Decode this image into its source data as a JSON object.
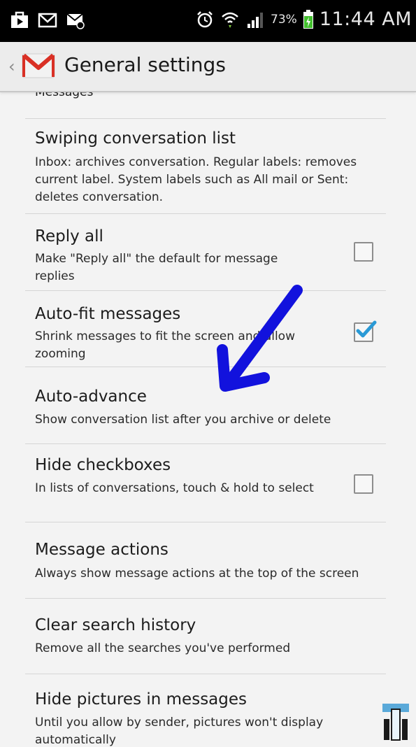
{
  "status_bar": {
    "battery_percent": "73%",
    "time": "11:44 AM"
  },
  "action_bar": {
    "title": "General settings"
  },
  "settings": {
    "partial_top": "Messages",
    "items": [
      {
        "title": "Swiping conversation list",
        "subtitle": "Inbox: archives conversation. Regular labels: removes current label. System labels such as All mail or Sent: deletes conversation.",
        "checkbox": null
      },
      {
        "title": "Reply all",
        "subtitle": "Make \"Reply all\" the default for message replies",
        "checkbox": false
      },
      {
        "title": "Auto-fit messages",
        "subtitle": "Shrink messages to fit the screen and allow zooming",
        "checkbox": true
      },
      {
        "title": "Auto-advance",
        "subtitle": "Show conversation list after you archive or delete",
        "checkbox": null
      },
      {
        "title": "Hide checkboxes",
        "subtitle": "In lists of conversations, touch & hold to select",
        "checkbox": false
      },
      {
        "title": "Message actions",
        "subtitle": "Always show message actions at the top of the screen",
        "checkbox": null
      },
      {
        "title": "Clear search history",
        "subtitle": "Remove all the searches you've performed",
        "checkbox": null
      },
      {
        "title": "Hide pictures in messages",
        "subtitle": "Until you allow by sender, pictures won't display automatically",
        "checkbox": null
      }
    ]
  },
  "colors": {
    "accent_check": "#2a9ad6",
    "annotation_arrow": "#1212dd",
    "gmail_red": "#d93025"
  }
}
